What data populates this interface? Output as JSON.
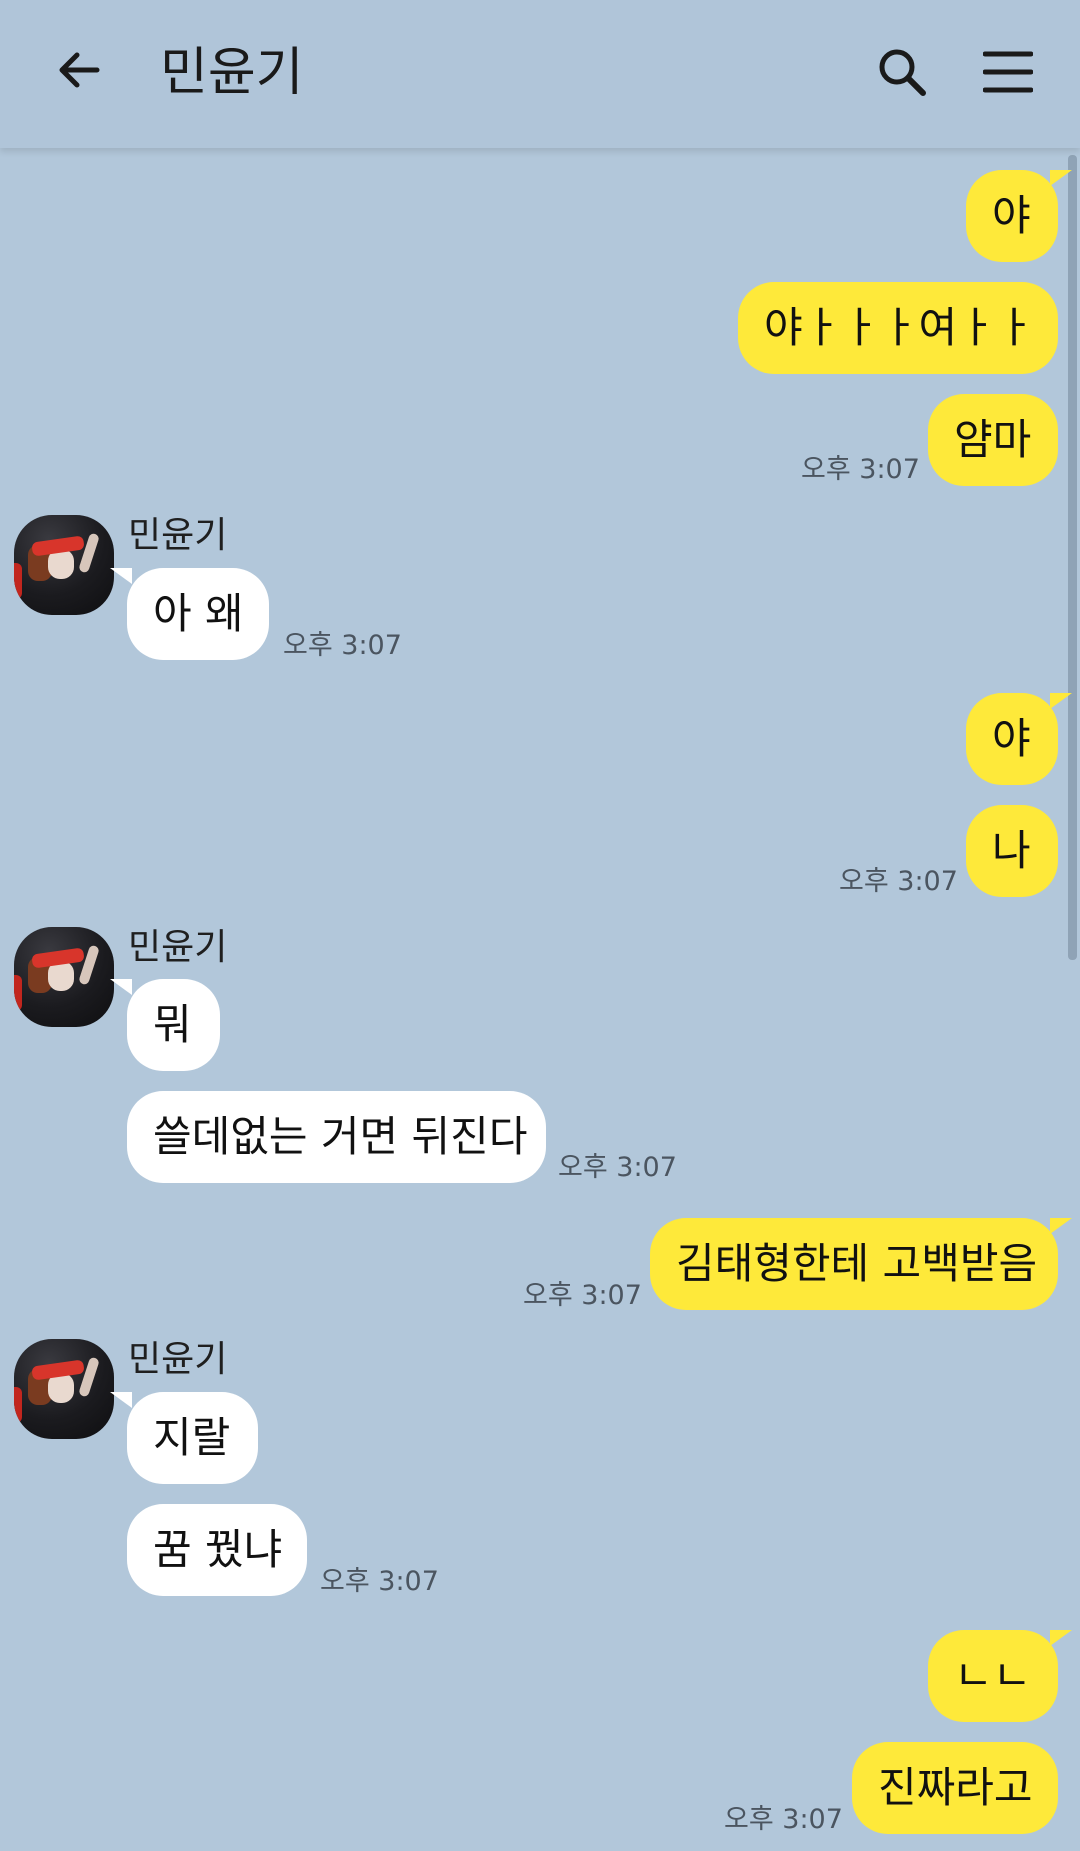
{
  "header": {
    "title": "민윤기",
    "back_icon": "arrow-left-icon",
    "search_icon": "search-icon",
    "menu_icon": "hamburger-menu-icon"
  },
  "colors": {
    "background": "#b2c7da",
    "my_bubble": "#fee93a",
    "their_bubble": "#ffffff"
  },
  "messages": [
    {
      "from": "me",
      "text": "야"
    },
    {
      "from": "me",
      "text": "야ㅏㅏㅏ여ㅏㅏ"
    },
    {
      "from": "me",
      "text": "얌마",
      "time": "오후 3:07"
    },
    {
      "from": "them",
      "sender": "민윤기",
      "text": "아 왜",
      "time": "오후 3:07"
    },
    {
      "from": "me",
      "text": "야"
    },
    {
      "from": "me",
      "text": "나",
      "time": "오후 3:07"
    },
    {
      "from": "them",
      "sender": "민윤기",
      "text": "뭐"
    },
    {
      "from": "them",
      "text": "쓸데없는 거면 뒤진다",
      "time": "오후 3:07"
    },
    {
      "from": "me",
      "text": "김태형한테 고백받음",
      "time": "오후 3:07"
    },
    {
      "from": "them",
      "sender": "민윤기",
      "text": "지랄"
    },
    {
      "from": "them",
      "text": "꿈 꿨냐",
      "time": "오후 3:07"
    },
    {
      "from": "me",
      "text": "ㄴㄴ"
    },
    {
      "from": "me",
      "text": "진짜라고",
      "time": "오후 3:07"
    }
  ]
}
